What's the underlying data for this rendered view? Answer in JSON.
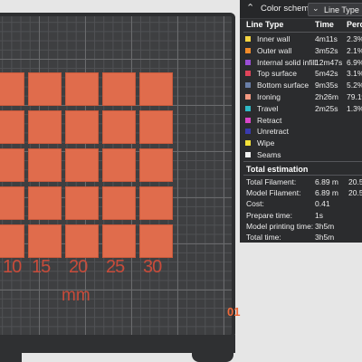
{
  "color_scheme": {
    "label": "Color scheme",
    "selected": "Line Type"
  },
  "line_type_table": {
    "headers": {
      "name": "Line Type",
      "time": "Time",
      "percent": "Percent"
    },
    "rows": [
      {
        "name": "Inner wall",
        "time": "4m11s",
        "percent": "2.3%",
        "color": "#f5d442"
      },
      {
        "name": "Outer wall",
        "time": "3m52s",
        "percent": "2.1%",
        "color": "#f28b2a"
      },
      {
        "name": "Internal solid infill",
        "time": "12m47s",
        "percent": "6.9%",
        "color": "#9b4fd6"
      },
      {
        "name": "Top surface",
        "time": "5m42s",
        "percent": "3.1%",
        "color": "#e0445a"
      },
      {
        "name": "Bottom surface",
        "time": "9m35s",
        "percent": "5.2%",
        "color": "#6a7fa8"
      },
      {
        "name": "Ironing",
        "time": "2h26m",
        "percent": "79.1%",
        "color": "#f29a82"
      },
      {
        "name": "Travel",
        "time": "2m25s",
        "percent": "1.3%",
        "color": "#2fb9c6"
      },
      {
        "name": "Retract",
        "time": "",
        "percent": "",
        "color": "#d946c8"
      },
      {
        "name": "Unretract",
        "time": "",
        "percent": "",
        "color": "#3a3bb0"
      },
      {
        "name": "Wipe",
        "time": "",
        "percent": "",
        "color": "#f5e23a"
      },
      {
        "name": "Seams",
        "time": "",
        "percent": "",
        "color": "#f2f2f2"
      }
    ]
  },
  "total_estimation": {
    "title": "Total estimation",
    "rows": [
      {
        "label": "Total Filament:",
        "value": "6.89 m",
        "extra": "20.55 g"
      },
      {
        "label": "Model Filament:",
        "value": "6.89 m",
        "extra": "20.55 g"
      },
      {
        "label": "Cost:",
        "value": "0.41",
        "extra": ""
      },
      {
        "label": "Prepare time:",
        "value": "1s",
        "extra": ""
      },
      {
        "label": "Model printing time:",
        "value": "3h5m",
        "extra": ""
      },
      {
        "label": "Total time:",
        "value": "3h5m",
        "extra": ""
      }
    ]
  },
  "plate": {
    "axis_ticks": [
      "10",
      "15",
      "20",
      "25",
      "30"
    ],
    "axis_unit": "mm",
    "plate_number": "01",
    "object_color": "#e06c4c"
  }
}
